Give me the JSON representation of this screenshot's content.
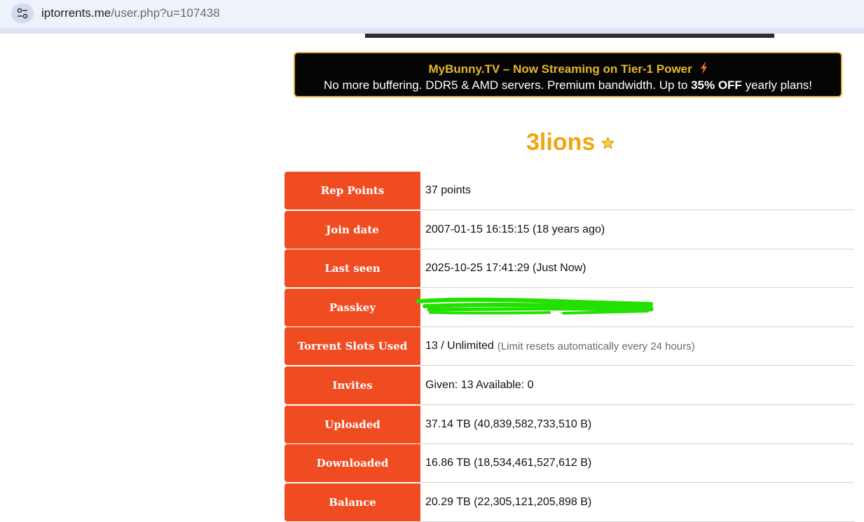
{
  "browser": {
    "url_host": "iptorrents.me",
    "url_path": "/user.php?u=107438"
  },
  "promo": {
    "title": "MyBunny.TV – Now Streaming on Tier-1 Power",
    "line_prefix": "No more buffering. DDR5 & AMD servers. Premium bandwidth. Up to",
    "line_bold": "35% OFF",
    "line_suffix": "yearly plans!",
    "icon": "lightning-bolt-icon"
  },
  "user": {
    "name": "3lions",
    "badge_icon": "star-icon"
  },
  "stats": [
    {
      "label": "Rep Points",
      "value": "37 points",
      "note": ""
    },
    {
      "label": "Join date",
      "value": "2007-01-15 16:15:15 (18 years ago)",
      "note": ""
    },
    {
      "label": "Last seen",
      "value": "2025-10-25 17:41:29 (Just Now)",
      "note": ""
    },
    {
      "label": "Passkey",
      "value": "",
      "note": ""
    },
    {
      "label": "Torrent Slots Used",
      "value": "13 / Unlimited",
      "note": "(Limit resets automatically every 24 hours)"
    },
    {
      "label": "Invites",
      "value": "Given: 13 Available: 0",
      "note": ""
    },
    {
      "label": "Uploaded",
      "value": "37.14 TB (40,839,582,733,510 B)",
      "note": ""
    },
    {
      "label": "Downloaded",
      "value": "16.86 TB (18,534,461,527,612 B)",
      "note": ""
    },
    {
      "label": "Balance",
      "value": "20.29 TB (22,305,121,205,898 B)",
      "note": ""
    }
  ],
  "colors": {
    "label_bg": "#f04c22",
    "username": "#f2a50e",
    "promo_border": "#e2b23a",
    "redaction": "#22e000"
  }
}
